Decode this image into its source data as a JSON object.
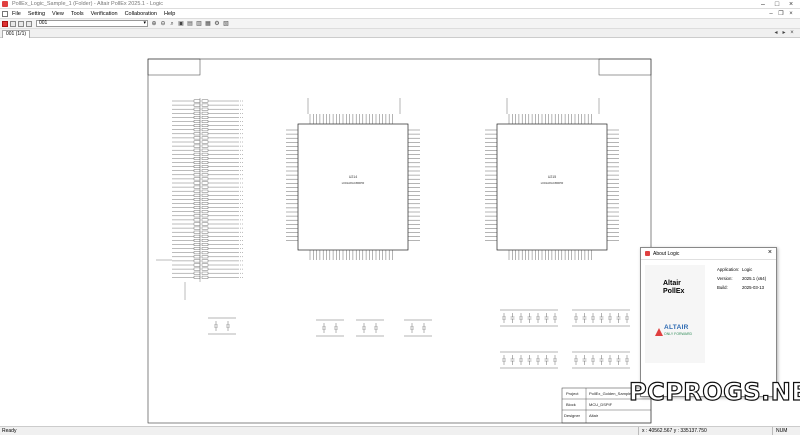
{
  "window": {
    "title": "PollEx_Logic_Sample_1 (Folder) - Altair PollEx 2025.1 - Logic"
  },
  "menu": {
    "items": [
      "File",
      "Setting",
      "View",
      "Tools",
      "Verification",
      "Collaboration",
      "Help"
    ]
  },
  "toolbar": {
    "selected_value": "001"
  },
  "tab": {
    "label": "001 (1/1)"
  },
  "schematic": {
    "chip1": {
      "ref": "U214",
      "part": "x001A8ACBRPR"
    },
    "chip2": {
      "ref": "U215",
      "part": "x001A8ACBRPR"
    }
  },
  "title_block": {
    "rows": [
      {
        "label": "Project",
        "value": "PollEx_Golden_Sample"
      },
      {
        "label": "Block",
        "value": "MCU_DSPIF"
      },
      {
        "label": "Designer",
        "value": "Altair"
      }
    ]
  },
  "about": {
    "title": "About Logic",
    "product_name_line1": "Altair",
    "product_name_line2": "PollEx",
    "brand": "ALTAIR",
    "brand_tagline": "ONLY FORWARD",
    "info": [
      {
        "label": "Application:",
        "value": "Logic"
      },
      {
        "label": "Version:",
        "value": "2025.1 (x64)"
      },
      {
        "label": "Build:",
        "value": "2025-03-13"
      }
    ]
  },
  "status": {
    "ready": "Ready",
    "coordinates": "x : 40562.567  y : 335137.750",
    "num_lock": "NUM"
  },
  "watermark": "PCPROGS.NET",
  "colors": {
    "accent_red": "#e04040",
    "altair_blue": "#2e6bb3",
    "altair_green": "#2e8b57"
  }
}
